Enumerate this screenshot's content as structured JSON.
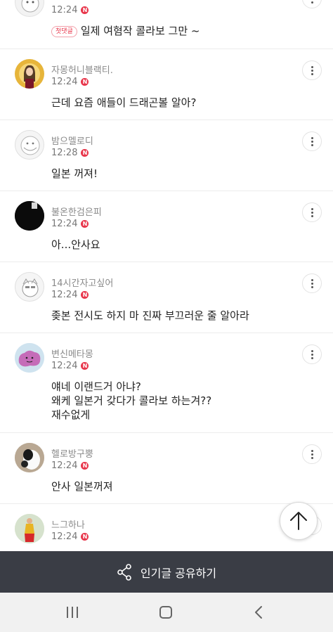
{
  "comments": [
    {
      "nick": "...",
      "time": "12:24",
      "badge": "N",
      "first_label": "첫댓글",
      "text": "일제 여혐작 콜라보 그만 ~"
    },
    {
      "nick": "자몽허니블랙티.",
      "time": "12:24",
      "badge": "N",
      "text": "근데 요즘 애들이 드래곤볼 알아?"
    },
    {
      "nick": "밤으멜로디",
      "time": "12:28",
      "badge": "N",
      "text": "일본 꺼져!"
    },
    {
      "nick": "불온한검은피",
      "time": "12:24",
      "badge": "N",
      "text": "아...안사요"
    },
    {
      "nick": "14시간자고싶어",
      "time": "12:24",
      "badge": "N",
      "text": "좆본 전시도 하지 마 진짜 부끄러운 줄 알아라"
    },
    {
      "nick": "변신메타몽",
      "time": "12:24",
      "badge": "N",
      "text_lines": [
        "얘네 이랜드거 아냐?",
        "왜케 일본거 갖다가 콜라보 하는겨??",
        "재수없게"
      ]
    },
    {
      "nick": "헬로방구뿡",
      "time": "12:24",
      "badge": "N",
      "text": "안사 일본꺼져"
    },
    {
      "nick": "느그하나",
      "time": "12:24",
      "badge": "N"
    }
  ],
  "share_bar": {
    "label": "인기글 공유하기",
    "icon": "share-icon"
  },
  "top_button": {
    "icon": "arrow-up-icon"
  },
  "nav": {
    "recent_icon": "recent-apps-icon",
    "home_icon": "home-icon",
    "back_icon": "back-icon"
  },
  "colors": {
    "accent": "#e8354a",
    "share_bar": "#3a3d45",
    "nav_bar": "#f1f1f1"
  }
}
